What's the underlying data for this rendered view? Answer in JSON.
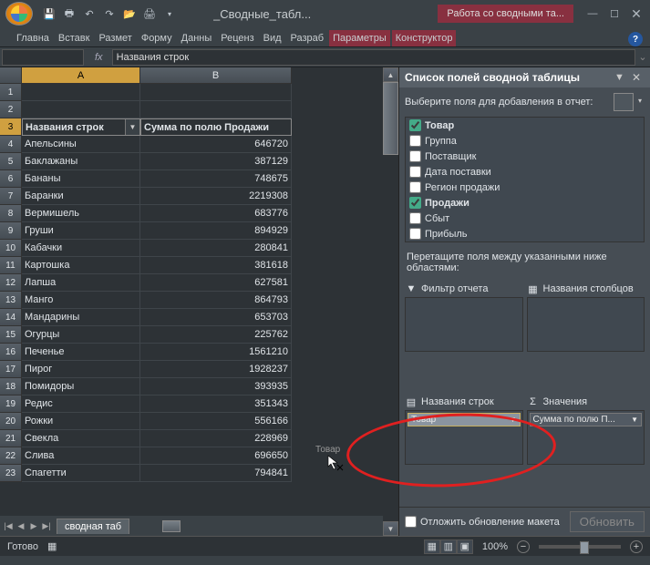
{
  "window": {
    "title": "_Сводные_табл...",
    "context_tab_group": "Работа со сводными та..."
  },
  "ribbon_tabs": [
    "Главна",
    "Вставк",
    "Размет",
    "Форму",
    "Данны",
    "Реценз",
    "Вид",
    "Разраб",
    "Параметры",
    "Конструктор"
  ],
  "namebox": "",
  "formula_bar": "Названия строк",
  "columns": [
    "A",
    "B"
  ],
  "pivot": {
    "header_a": "Названия строк",
    "header_b": "Сумма по полю Продажи",
    "rows": [
      {
        "n": 4,
        "a": "Апельсины",
        "b": "646720"
      },
      {
        "n": 5,
        "a": "Баклажаны",
        "b": "387129"
      },
      {
        "n": 6,
        "a": "Бананы",
        "b": "748675"
      },
      {
        "n": 7,
        "a": "Баранки",
        "b": "2219308"
      },
      {
        "n": 8,
        "a": "Вермишель",
        "b": "683776"
      },
      {
        "n": 9,
        "a": "Груши",
        "b": "894929"
      },
      {
        "n": 10,
        "a": "Кабачки",
        "b": "280841"
      },
      {
        "n": 11,
        "a": "Картошка",
        "b": "381618"
      },
      {
        "n": 12,
        "a": "Лапша",
        "b": "627581"
      },
      {
        "n": 13,
        "a": "Манго",
        "b": "864793"
      },
      {
        "n": 14,
        "a": "Мандарины",
        "b": "653703"
      },
      {
        "n": 15,
        "a": "Огурцы",
        "b": "225762"
      },
      {
        "n": 16,
        "a": "Печенье",
        "b": "1561210"
      },
      {
        "n": 17,
        "a": "Пирог",
        "b": "1928237"
      },
      {
        "n": 18,
        "a": "Помидоры",
        "b": "393935"
      },
      {
        "n": 19,
        "a": "Редис",
        "b": "351343"
      },
      {
        "n": 20,
        "a": "Рожки",
        "b": "556166"
      },
      {
        "n": 21,
        "a": "Свекла",
        "b": "228969"
      },
      {
        "n": 22,
        "a": "Слива",
        "b": "696650"
      },
      {
        "n": 23,
        "a": "Спагетти",
        "b": "794841"
      }
    ]
  },
  "sheet_tab": "сводная таб",
  "task_pane": {
    "title": "Список полей сводной таблицы",
    "subtitle": "Выберите поля для добавления в отчет:",
    "fields": [
      {
        "name": "Товар",
        "checked": true
      },
      {
        "name": "Группа",
        "checked": false
      },
      {
        "name": "Поставщик",
        "checked": false
      },
      {
        "name": "Дата поставки",
        "checked": false
      },
      {
        "name": "Регион продажи",
        "checked": false
      },
      {
        "name": "Продажи",
        "checked": true
      },
      {
        "name": "Сбыт",
        "checked": false
      },
      {
        "name": "Прибыль",
        "checked": false
      }
    ],
    "drag_hint": "Перетащите поля между указанными ниже областями:",
    "zones": {
      "filter": "Фильтр отчета",
      "columns": "Названия столбцов",
      "rows": "Названия строк",
      "values": "Значения"
    },
    "row_items": [
      "Товар"
    ],
    "value_items": [
      "Сумма по полю П..."
    ],
    "defer_label": "Отложить обновление макета",
    "update_btn": "Обновить"
  },
  "drag_ghost": "Товар",
  "status": {
    "ready": "Готово",
    "zoom": "100%"
  }
}
